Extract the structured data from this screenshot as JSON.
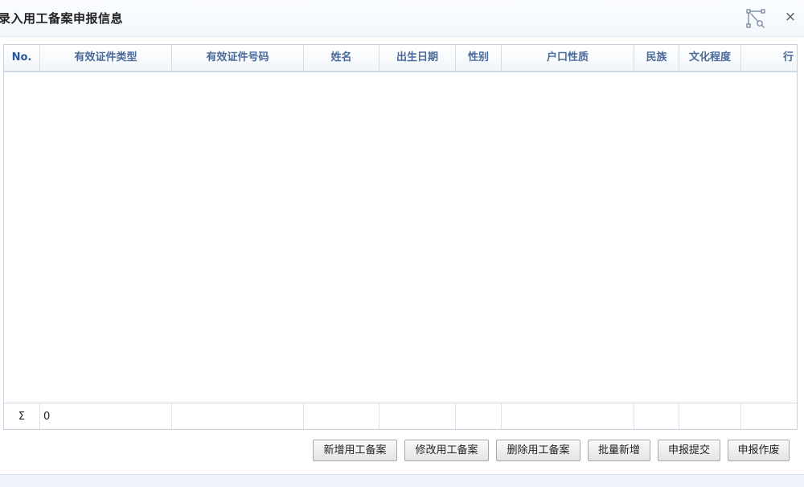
{
  "window": {
    "title": "录入用工备案申报信息",
    "maximize_icon": "maximize-icon",
    "close_label": "×"
  },
  "table": {
    "columns": [
      "No.",
      "有效证件类型",
      "有效证件号码",
      "姓名",
      "出生日期",
      "性别",
      "户口性质",
      "民族",
      "文化程度",
      "行"
    ],
    "rows": [],
    "summary": {
      "symbol": "Σ",
      "count": "0"
    }
  },
  "buttons": {
    "add": "新增用工备案",
    "edit": "修改用工备案",
    "delete": "删除用工备案",
    "batch_add": "批量新增",
    "submit": "申报提交",
    "void": "申报作废"
  },
  "colors": {
    "header_text": "#4a6a9a",
    "border": "#c5cfdb"
  }
}
